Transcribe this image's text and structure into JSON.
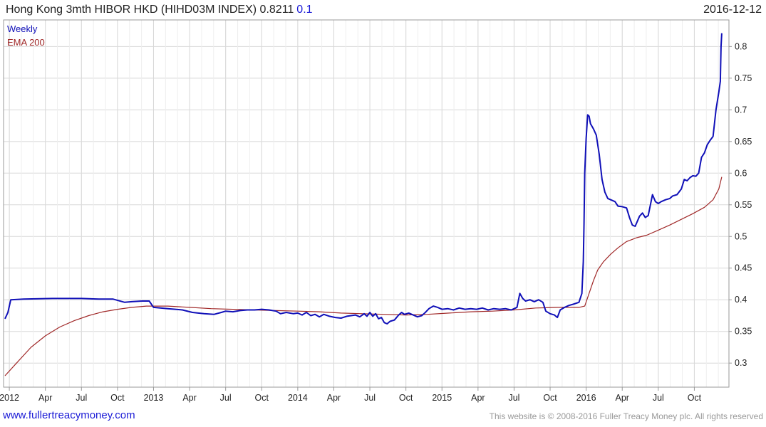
{
  "header": {
    "title": "Hong Kong 3mth HIBOR HKD (HIHD03M INDEX) 0.8211",
    "change": "0.1",
    "date": "2016-12-12"
  },
  "footer": {
    "left": "www.fullertreacymoney.com",
    "right": "This website is © 2008-2016 Fuller Treacy Money plc. All rights reserved"
  },
  "colors": {
    "weekly": "#1010b8",
    "ema": "#a02828",
    "grid": "#d8d8d8",
    "axis": "#999999"
  },
  "chart_data": {
    "type": "line",
    "xlim": [
      2011.96,
      2016.99
    ],
    "ylim": [
      0.262,
      0.842
    ],
    "y_ticks": [
      0.3,
      0.35,
      0.4,
      0.45,
      0.5,
      0.55,
      0.6,
      0.65,
      0.7,
      0.75,
      0.8
    ],
    "y_tick_labels": [
      "0.3",
      "0.35",
      "0.4",
      "0.45",
      "0.5",
      "0.55",
      "0.6",
      "0.65",
      "0.7",
      "0.75",
      "0.8"
    ],
    "x_ticks": [
      {
        "x": 2012.0,
        "label": "2012"
      },
      {
        "x": 2012.25,
        "label": "Apr"
      },
      {
        "x": 2012.5,
        "label": "Jul"
      },
      {
        "x": 2012.75,
        "label": "Oct"
      },
      {
        "x": 2013.0,
        "label": "2013"
      },
      {
        "x": 2013.25,
        "label": "Apr"
      },
      {
        "x": 2013.5,
        "label": "Jul"
      },
      {
        "x": 2013.75,
        "label": "Oct"
      },
      {
        "x": 2014.0,
        "label": "2014"
      },
      {
        "x": 2014.25,
        "label": "Apr"
      },
      {
        "x": 2014.5,
        "label": "Jul"
      },
      {
        "x": 2014.75,
        "label": "Oct"
      },
      {
        "x": 2015.0,
        "label": "2015"
      },
      {
        "x": 2015.25,
        "label": "Apr"
      },
      {
        "x": 2015.5,
        "label": "Jul"
      },
      {
        "x": 2015.75,
        "label": "Oct"
      },
      {
        "x": 2016.0,
        "label": "2016"
      },
      {
        "x": 2016.25,
        "label": "Apr"
      },
      {
        "x": 2016.5,
        "label": "Jul"
      },
      {
        "x": 2016.75,
        "label": "Oct"
      }
    ],
    "grid": true,
    "legend_position": "top-left",
    "series": [
      {
        "name": "Weekly",
        "color": "#1010b8",
        "points": [
          [
            2011.97,
            0.37
          ],
          [
            2011.99,
            0.38
          ],
          [
            2012.01,
            0.4
          ],
          [
            2012.1,
            0.401
          ],
          [
            2012.3,
            0.402
          ],
          [
            2012.5,
            0.402
          ],
          [
            2012.62,
            0.401
          ],
          [
            2012.72,
            0.401
          ],
          [
            2012.8,
            0.396
          ],
          [
            2012.85,
            0.397
          ],
          [
            2012.92,
            0.398
          ],
          [
            2012.97,
            0.398
          ],
          [
            2013.0,
            0.388
          ],
          [
            2013.1,
            0.386
          ],
          [
            2013.2,
            0.384
          ],
          [
            2013.27,
            0.38
          ],
          [
            2013.35,
            0.378
          ],
          [
            2013.42,
            0.377
          ],
          [
            2013.47,
            0.38
          ],
          [
            2013.5,
            0.382
          ],
          [
            2013.55,
            0.381
          ],
          [
            2013.6,
            0.383
          ],
          [
            2013.65,
            0.384
          ],
          [
            2013.7,
            0.384
          ],
          [
            2013.75,
            0.385
          ],
          [
            2013.8,
            0.384
          ],
          [
            2013.85,
            0.382
          ],
          [
            2013.88,
            0.378
          ],
          [
            2013.92,
            0.38
          ],
          [
            2013.97,
            0.378
          ],
          [
            2014.0,
            0.379
          ],
          [
            2014.03,
            0.376
          ],
          [
            2014.06,
            0.38
          ],
          [
            2014.09,
            0.375
          ],
          [
            2014.12,
            0.377
          ],
          [
            2014.15,
            0.373
          ],
          [
            2014.18,
            0.377
          ],
          [
            2014.22,
            0.374
          ],
          [
            2014.26,
            0.372
          ],
          [
            2014.3,
            0.371
          ],
          [
            2014.34,
            0.374
          ],
          [
            2014.37,
            0.375
          ],
          [
            2014.4,
            0.376
          ],
          [
            2014.43,
            0.373
          ],
          [
            2014.46,
            0.378
          ],
          [
            2014.48,
            0.374
          ],
          [
            2014.5,
            0.38
          ],
          [
            2014.52,
            0.374
          ],
          [
            2014.54,
            0.378
          ],
          [
            2014.56,
            0.37
          ],
          [
            2014.58,
            0.372
          ],
          [
            2014.6,
            0.364
          ],
          [
            2014.62,
            0.362
          ],
          [
            2014.64,
            0.366
          ],
          [
            2014.67,
            0.368
          ],
          [
            2014.7,
            0.376
          ],
          [
            2014.72,
            0.38
          ],
          [
            2014.74,
            0.377
          ],
          [
            2014.77,
            0.379
          ],
          [
            2014.8,
            0.376
          ],
          [
            2014.83,
            0.373
          ],
          [
            2014.86,
            0.375
          ],
          [
            2014.88,
            0.379
          ],
          [
            2014.91,
            0.386
          ],
          [
            2014.94,
            0.39
          ],
          [
            2014.97,
            0.388
          ],
          [
            2015.0,
            0.385
          ],
          [
            2015.04,
            0.386
          ],
          [
            2015.08,
            0.384
          ],
          [
            2015.12,
            0.387
          ],
          [
            2015.16,
            0.385
          ],
          [
            2015.2,
            0.386
          ],
          [
            2015.24,
            0.385
          ],
          [
            2015.28,
            0.387
          ],
          [
            2015.32,
            0.384
          ],
          [
            2015.36,
            0.386
          ],
          [
            2015.4,
            0.385
          ],
          [
            2015.44,
            0.386
          ],
          [
            2015.48,
            0.384
          ],
          [
            2015.52,
            0.388
          ],
          [
            2015.54,
            0.41
          ],
          [
            2015.56,
            0.402
          ],
          [
            2015.58,
            0.398
          ],
          [
            2015.61,
            0.4
          ],
          [
            2015.64,
            0.397
          ],
          [
            2015.67,
            0.4
          ],
          [
            2015.7,
            0.396
          ],
          [
            2015.72,
            0.382
          ],
          [
            2015.75,
            0.378
          ],
          [
            2015.78,
            0.376
          ],
          [
            2015.8,
            0.372
          ],
          [
            2015.82,
            0.384
          ],
          [
            2015.85,
            0.388
          ],
          [
            2015.88,
            0.391
          ],
          [
            2015.91,
            0.393
          ],
          [
            2015.95,
            0.396
          ],
          [
            2015.97,
            0.41
          ],
          [
            2015.98,
            0.46
          ],
          [
            2015.985,
            0.52
          ],
          [
            2015.99,
            0.6
          ],
          [
            2016.0,
            0.655
          ],
          [
            2016.01,
            0.692
          ],
          [
            2016.02,
            0.69
          ],
          [
            2016.03,
            0.678
          ],
          [
            2016.05,
            0.67
          ],
          [
            2016.07,
            0.66
          ],
          [
            2016.09,
            0.63
          ],
          [
            2016.11,
            0.59
          ],
          [
            2016.13,
            0.57
          ],
          [
            2016.15,
            0.56
          ],
          [
            2016.18,
            0.557
          ],
          [
            2016.2,
            0.555
          ],
          [
            2016.22,
            0.548
          ],
          [
            2016.25,
            0.547
          ],
          [
            2016.28,
            0.545
          ],
          [
            2016.3,
            0.53
          ],
          [
            2016.32,
            0.518
          ],
          [
            2016.34,
            0.516
          ],
          [
            2016.37,
            0.532
          ],
          [
            2016.39,
            0.537
          ],
          [
            2016.41,
            0.53
          ],
          [
            2016.43,
            0.533
          ],
          [
            2016.46,
            0.566
          ],
          [
            2016.48,
            0.555
          ],
          [
            2016.5,
            0.552
          ],
          [
            2016.52,
            0.555
          ],
          [
            2016.55,
            0.558
          ],
          [
            2016.58,
            0.56
          ],
          [
            2016.6,
            0.564
          ],
          [
            2016.63,
            0.566
          ],
          [
            2016.66,
            0.575
          ],
          [
            2016.68,
            0.59
          ],
          [
            2016.7,
            0.588
          ],
          [
            2016.72,
            0.593
          ],
          [
            2016.74,
            0.596
          ],
          [
            2016.76,
            0.595
          ],
          [
            2016.78,
            0.6
          ],
          [
            2016.8,
            0.625
          ],
          [
            2016.82,
            0.632
          ],
          [
            2016.84,
            0.645
          ],
          [
            2016.86,
            0.652
          ],
          [
            2016.88,
            0.658
          ],
          [
            2016.9,
            0.7
          ],
          [
            2016.92,
            0.728
          ],
          [
            2016.93,
            0.745
          ],
          [
            2016.935,
            0.8
          ],
          [
            2016.94,
            0.821
          ]
        ]
      },
      {
        "name": "EMA 200",
        "color": "#a02828",
        "points": [
          [
            2011.97,
            0.28
          ],
          [
            2012.05,
            0.3
          ],
          [
            2012.15,
            0.325
          ],
          [
            2012.25,
            0.343
          ],
          [
            2012.35,
            0.357
          ],
          [
            2012.45,
            0.367
          ],
          [
            2012.55,
            0.375
          ],
          [
            2012.65,
            0.381
          ],
          [
            2012.75,
            0.385
          ],
          [
            2012.85,
            0.388
          ],
          [
            2012.95,
            0.39
          ],
          [
            2013.0,
            0.39
          ],
          [
            2013.1,
            0.39
          ],
          [
            2013.25,
            0.388
          ],
          [
            2013.4,
            0.386
          ],
          [
            2013.55,
            0.385
          ],
          [
            2013.7,
            0.384
          ],
          [
            2013.85,
            0.383
          ],
          [
            2014.0,
            0.382
          ],
          [
            2014.15,
            0.381
          ],
          [
            2014.3,
            0.379
          ],
          [
            2014.45,
            0.378
          ],
          [
            2014.6,
            0.377
          ],
          [
            2014.75,
            0.376
          ],
          [
            2014.9,
            0.377
          ],
          [
            2015.05,
            0.379
          ],
          [
            2015.2,
            0.381
          ],
          [
            2015.35,
            0.382
          ],
          [
            2015.5,
            0.384
          ],
          [
            2015.65,
            0.387
          ],
          [
            2015.8,
            0.388
          ],
          [
            2015.95,
            0.388
          ],
          [
            2015.99,
            0.39
          ],
          [
            2016.02,
            0.41
          ],
          [
            2016.05,
            0.43
          ],
          [
            2016.08,
            0.447
          ],
          [
            2016.12,
            0.46
          ],
          [
            2016.17,
            0.472
          ],
          [
            2016.22,
            0.482
          ],
          [
            2016.28,
            0.492
          ],
          [
            2016.35,
            0.498
          ],
          [
            2016.42,
            0.502
          ],
          [
            2016.5,
            0.51
          ],
          [
            2016.58,
            0.518
          ],
          [
            2016.66,
            0.527
          ],
          [
            2016.74,
            0.536
          ],
          [
            2016.82,
            0.546
          ],
          [
            2016.88,
            0.558
          ],
          [
            2016.92,
            0.575
          ],
          [
            2016.94,
            0.594
          ]
        ]
      }
    ]
  }
}
